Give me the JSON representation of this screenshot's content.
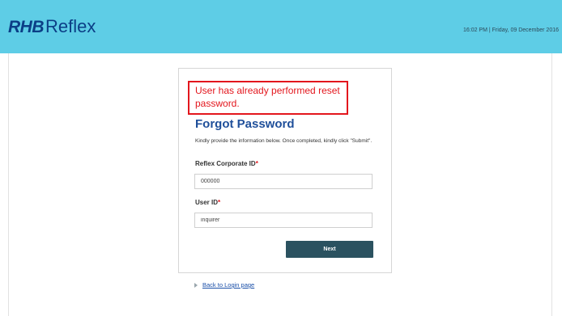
{
  "header": {
    "logo_rhb": "RHB",
    "logo_reflex": "Reflex",
    "datetime": "16:02 PM | Friday, 09 December 2016"
  },
  "form": {
    "error_message": "User has already performed reset password.",
    "title": "Forgot Password",
    "instructions": "Kindly provide the information below. Once completed, kindly click \"Submit\".",
    "corporate_id_label": "Reflex Corporate ID",
    "corporate_id_value": "000000",
    "user_id_label": "User ID",
    "user_id_value": "inquirer",
    "required_marker": "*",
    "next_label": "Next"
  },
  "footer": {
    "back_link": "Back to Login page"
  },
  "colors": {
    "header_bg": "#5ecde6",
    "brand_blue": "#0b3e86",
    "error_red": "#e3161d",
    "button_bg": "#2b5260",
    "link_blue": "#1a4fa8"
  }
}
